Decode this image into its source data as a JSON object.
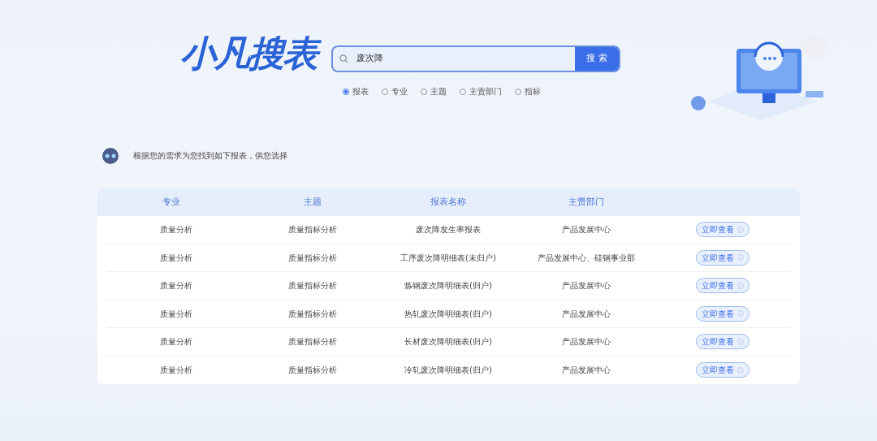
{
  "logo": {
    "text": "小凡搜表"
  },
  "search": {
    "value": "废次降",
    "button": "搜 索"
  },
  "search_types": [
    {
      "label": "报表",
      "selected": true
    },
    {
      "label": "专业",
      "selected": false
    },
    {
      "label": "主题",
      "selected": false
    },
    {
      "label": "主责部门",
      "selected": false
    },
    {
      "label": "指标",
      "selected": false
    }
  ],
  "assistant_message": "根据您的需求为您找到如下报表，供您选择",
  "table": {
    "columns": [
      "专业",
      "主题",
      "报表名称",
      "主责部门"
    ],
    "rows": [
      {
        "cells": [
          "质量分析",
          "质量指标分析",
          "废次降发生率报表",
          "产品发展中心"
        ],
        "action": "立即查看"
      },
      {
        "cells": [
          "质量分析",
          "质量指标分析",
          "工序废次降明细表(未归户)",
          "产品发展中心、硅钢事业部"
        ],
        "action": "立即查看"
      },
      {
        "cells": [
          "质量分析",
          "质量指标分析",
          "炼钢废次降明细表(归户)",
          "产品发展中心"
        ],
        "action": "立即查看"
      },
      {
        "cells": [
          "质量分析",
          "质量指标分析",
          "热轧废次降明细表(归户)",
          "产品发展中心"
        ],
        "action": "立即查看"
      },
      {
        "cells": [
          "质量分析",
          "质量指标分析",
          "长材废次降明细表(归户)",
          "产品发展中心"
        ],
        "action": "立即查看"
      },
      {
        "cells": [
          "质量分析",
          "质量指标分析",
          "冷轧废次降明细表(归户)",
          "产品发展中心"
        ],
        "action": "立即查看"
      }
    ]
  }
}
